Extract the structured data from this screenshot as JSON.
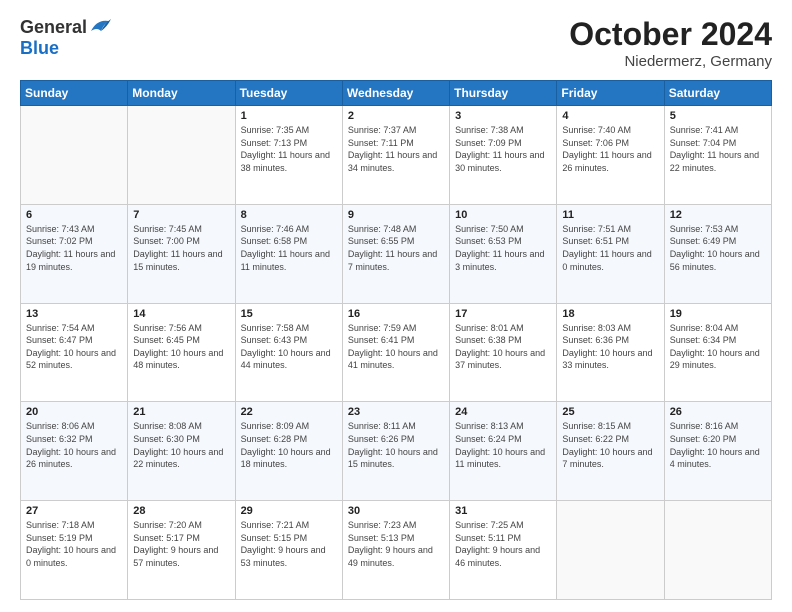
{
  "header": {
    "logo_general": "General",
    "logo_blue": "Blue",
    "month": "October 2024",
    "location": "Niedermerz, Germany"
  },
  "weekdays": [
    "Sunday",
    "Monday",
    "Tuesday",
    "Wednesday",
    "Thursday",
    "Friday",
    "Saturday"
  ],
  "weeks": [
    [
      {
        "day": "",
        "info": ""
      },
      {
        "day": "",
        "info": ""
      },
      {
        "day": "1",
        "info": "Sunrise: 7:35 AM\nSunset: 7:13 PM\nDaylight: 11 hours and 38 minutes."
      },
      {
        "day": "2",
        "info": "Sunrise: 7:37 AM\nSunset: 7:11 PM\nDaylight: 11 hours and 34 minutes."
      },
      {
        "day": "3",
        "info": "Sunrise: 7:38 AM\nSunset: 7:09 PM\nDaylight: 11 hours and 30 minutes."
      },
      {
        "day": "4",
        "info": "Sunrise: 7:40 AM\nSunset: 7:06 PM\nDaylight: 11 hours and 26 minutes."
      },
      {
        "day": "5",
        "info": "Sunrise: 7:41 AM\nSunset: 7:04 PM\nDaylight: 11 hours and 22 minutes."
      }
    ],
    [
      {
        "day": "6",
        "info": "Sunrise: 7:43 AM\nSunset: 7:02 PM\nDaylight: 11 hours and 19 minutes."
      },
      {
        "day": "7",
        "info": "Sunrise: 7:45 AM\nSunset: 7:00 PM\nDaylight: 11 hours and 15 minutes."
      },
      {
        "day": "8",
        "info": "Sunrise: 7:46 AM\nSunset: 6:58 PM\nDaylight: 11 hours and 11 minutes."
      },
      {
        "day": "9",
        "info": "Sunrise: 7:48 AM\nSunset: 6:55 PM\nDaylight: 11 hours and 7 minutes."
      },
      {
        "day": "10",
        "info": "Sunrise: 7:50 AM\nSunset: 6:53 PM\nDaylight: 11 hours and 3 minutes."
      },
      {
        "day": "11",
        "info": "Sunrise: 7:51 AM\nSunset: 6:51 PM\nDaylight: 11 hours and 0 minutes."
      },
      {
        "day": "12",
        "info": "Sunrise: 7:53 AM\nSunset: 6:49 PM\nDaylight: 10 hours and 56 minutes."
      }
    ],
    [
      {
        "day": "13",
        "info": "Sunrise: 7:54 AM\nSunset: 6:47 PM\nDaylight: 10 hours and 52 minutes."
      },
      {
        "day": "14",
        "info": "Sunrise: 7:56 AM\nSunset: 6:45 PM\nDaylight: 10 hours and 48 minutes."
      },
      {
        "day": "15",
        "info": "Sunrise: 7:58 AM\nSunset: 6:43 PM\nDaylight: 10 hours and 44 minutes."
      },
      {
        "day": "16",
        "info": "Sunrise: 7:59 AM\nSunset: 6:41 PM\nDaylight: 10 hours and 41 minutes."
      },
      {
        "day": "17",
        "info": "Sunrise: 8:01 AM\nSunset: 6:38 PM\nDaylight: 10 hours and 37 minutes."
      },
      {
        "day": "18",
        "info": "Sunrise: 8:03 AM\nSunset: 6:36 PM\nDaylight: 10 hours and 33 minutes."
      },
      {
        "day": "19",
        "info": "Sunrise: 8:04 AM\nSunset: 6:34 PM\nDaylight: 10 hours and 29 minutes."
      }
    ],
    [
      {
        "day": "20",
        "info": "Sunrise: 8:06 AM\nSunset: 6:32 PM\nDaylight: 10 hours and 26 minutes."
      },
      {
        "day": "21",
        "info": "Sunrise: 8:08 AM\nSunset: 6:30 PM\nDaylight: 10 hours and 22 minutes."
      },
      {
        "day": "22",
        "info": "Sunrise: 8:09 AM\nSunset: 6:28 PM\nDaylight: 10 hours and 18 minutes."
      },
      {
        "day": "23",
        "info": "Sunrise: 8:11 AM\nSunset: 6:26 PM\nDaylight: 10 hours and 15 minutes."
      },
      {
        "day": "24",
        "info": "Sunrise: 8:13 AM\nSunset: 6:24 PM\nDaylight: 10 hours and 11 minutes."
      },
      {
        "day": "25",
        "info": "Sunrise: 8:15 AM\nSunset: 6:22 PM\nDaylight: 10 hours and 7 minutes."
      },
      {
        "day": "26",
        "info": "Sunrise: 8:16 AM\nSunset: 6:20 PM\nDaylight: 10 hours and 4 minutes."
      }
    ],
    [
      {
        "day": "27",
        "info": "Sunrise: 7:18 AM\nSunset: 5:19 PM\nDaylight: 10 hours and 0 minutes."
      },
      {
        "day": "28",
        "info": "Sunrise: 7:20 AM\nSunset: 5:17 PM\nDaylight: 9 hours and 57 minutes."
      },
      {
        "day": "29",
        "info": "Sunrise: 7:21 AM\nSunset: 5:15 PM\nDaylight: 9 hours and 53 minutes."
      },
      {
        "day": "30",
        "info": "Sunrise: 7:23 AM\nSunset: 5:13 PM\nDaylight: 9 hours and 49 minutes."
      },
      {
        "day": "31",
        "info": "Sunrise: 7:25 AM\nSunset: 5:11 PM\nDaylight: 9 hours and 46 minutes."
      },
      {
        "day": "",
        "info": ""
      },
      {
        "day": "",
        "info": ""
      }
    ]
  ]
}
